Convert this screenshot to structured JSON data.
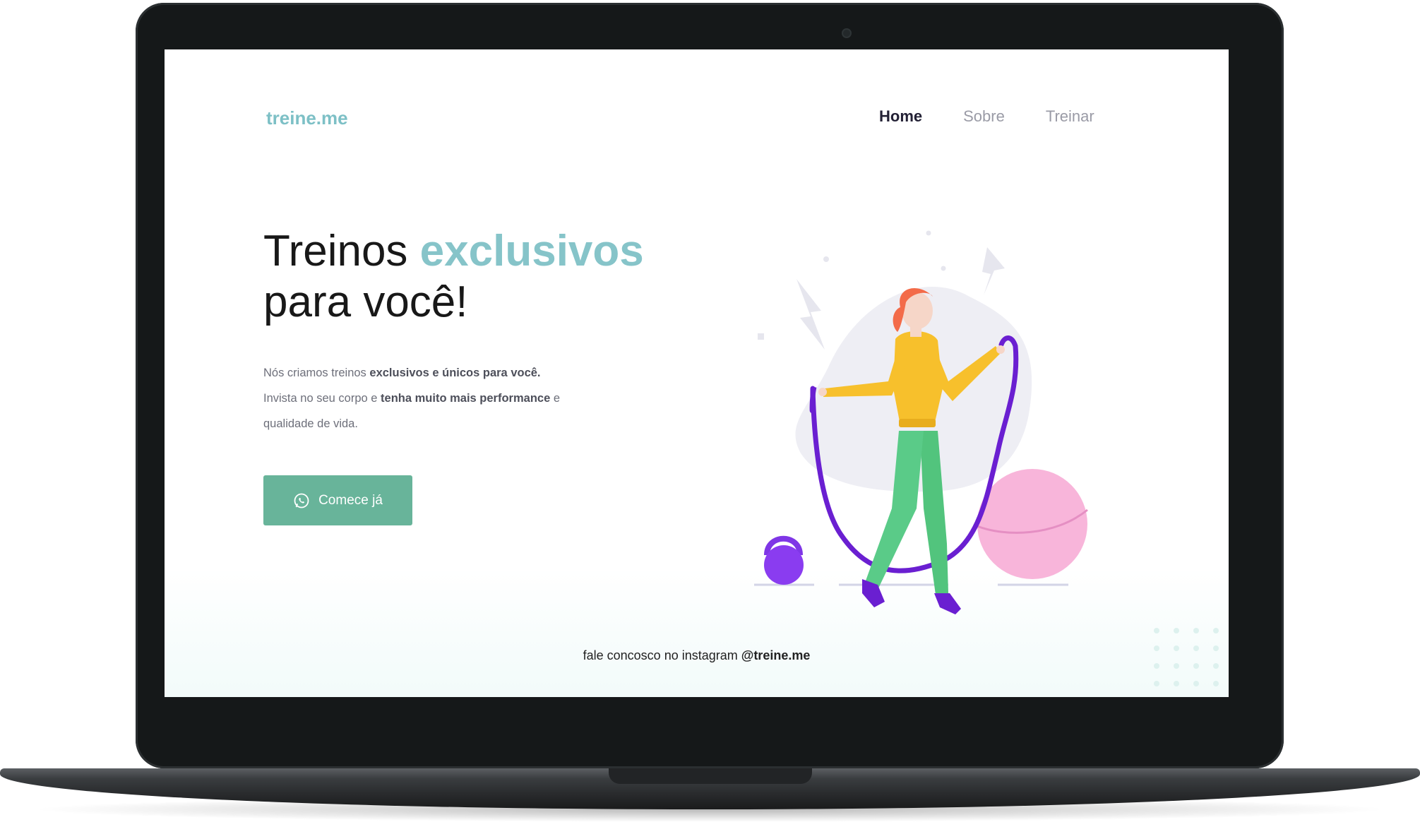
{
  "brand": {
    "logo": "treine.me",
    "accent_color": "#86c4c9"
  },
  "nav": {
    "items": [
      {
        "label": "Home",
        "active": true
      },
      {
        "label": "Sobre",
        "active": false
      },
      {
        "label": "Treinar",
        "active": false
      }
    ]
  },
  "hero": {
    "title_plain": "Treinos",
    "title_accent": "exclusivos",
    "title_line2": "para você!",
    "text": {
      "p1_plain": "Nós criamos treinos",
      "p1_bold": "exclusivos e únicos para você.",
      "p2_plain": "Invista no seu corpo e",
      "p2_bold": "tenha muito mais performance",
      "p2_end": "e",
      "p3": "qualidade de vida."
    }
  },
  "cta": {
    "label": "Comece já",
    "icon": "whatsapp-icon",
    "color": "#68b49a"
  },
  "footer": {
    "text": "fale concosco no instagram",
    "handle": "@treine.me"
  }
}
